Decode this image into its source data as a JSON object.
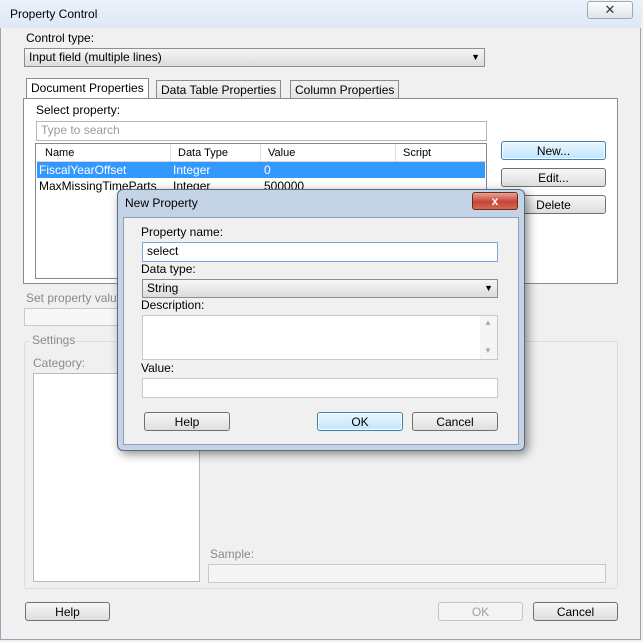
{
  "window": {
    "title": "Property Control",
    "close_glyph": "✕"
  },
  "control_type": {
    "label": "Control type:",
    "value": "Input field (multiple lines)"
  },
  "tabs": [
    {
      "label": "Document Properties",
      "active": true
    },
    {
      "label": "Data Table Properties",
      "active": false
    },
    {
      "label": "Column Properties",
      "active": false
    }
  ],
  "select_property": {
    "label": "Select property:",
    "search_placeholder": "Type to search"
  },
  "table": {
    "headers": [
      "Name",
      "Data Type",
      "Value",
      "Script"
    ],
    "rows": [
      {
        "name": "FiscalYearOffset",
        "type": "Integer",
        "value": "0",
        "script": "",
        "selected": true
      },
      {
        "name": "MaxMissingTimeParts",
        "type": "Integer",
        "value": "500000",
        "script": "",
        "selected": false
      }
    ]
  },
  "side_buttons": {
    "new": "New...",
    "edit": "Edit...",
    "delete": "Delete"
  },
  "set_property": {
    "label": "Set property valu"
  },
  "settings": {
    "label": "Settings",
    "category_label": "Category:",
    "sample_label": "Sample:"
  },
  "footer": {
    "help": "Help",
    "ok": "OK",
    "cancel": "Cancel"
  },
  "new_property": {
    "title": "New Property",
    "close_glyph": "x",
    "name_label": "Property name:",
    "name_value": "select",
    "type_label": "Data type:",
    "type_value": "String",
    "description_label": "Description:",
    "value_label": "Value:",
    "help": "Help",
    "ok": "OK",
    "cancel": "Cancel"
  },
  "colors": {
    "selection": "#3399ff",
    "title_gradient": "#dfe8f4",
    "modal_frame": "#c4d3e6",
    "close_red": "#c7443a"
  }
}
